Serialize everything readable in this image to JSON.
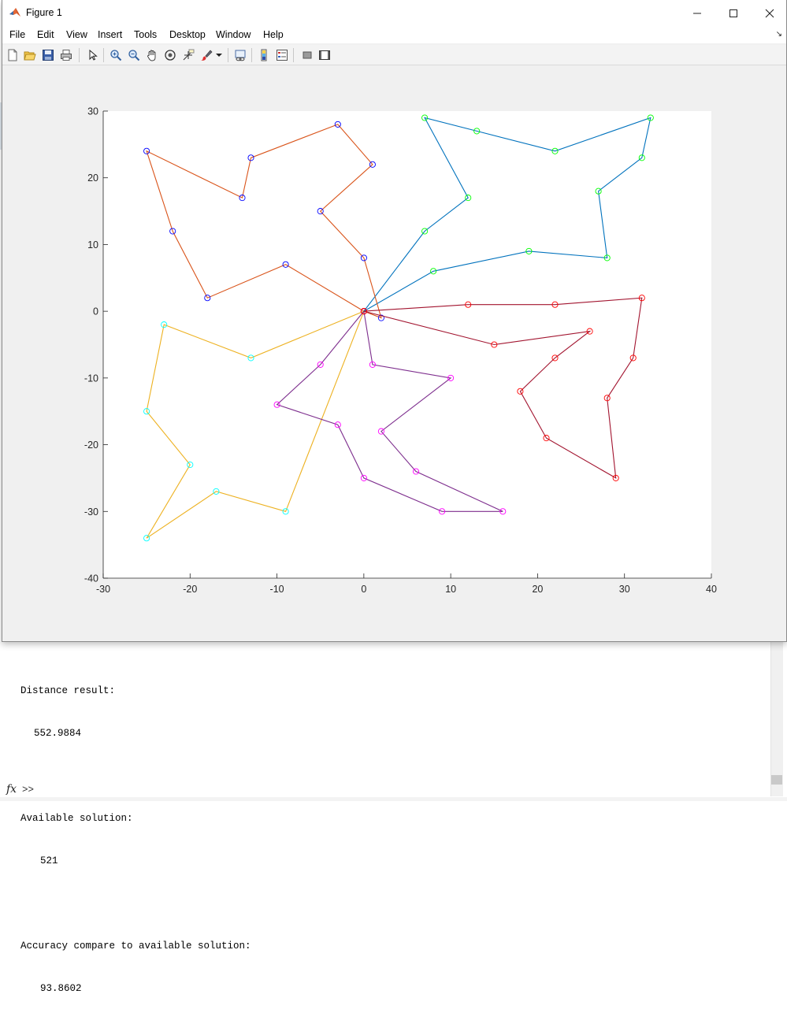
{
  "window": {
    "title": "Figure 1",
    "icon": "matlab-icon"
  },
  "menu": [
    "File",
    "Edit",
    "View",
    "Insert",
    "Tools",
    "Desktop",
    "Window",
    "Help"
  ],
  "toolbar": {
    "buttons": [
      "new-figure-icon",
      "open-file-icon",
      "save-icon",
      "print-icon",
      "edit-plot-arrow-icon",
      "zoom-in-icon",
      "zoom-out-icon",
      "pan-hand-icon",
      "rotate-3d-icon",
      "data-cursor-icon",
      "brush-icon",
      "brush-dropdown-icon",
      "link-plot-icon",
      "insert-colorbar-icon",
      "insert-legend-icon",
      "hide-plot-tools-icon",
      "show-plot-tools-icon"
    ]
  },
  "chart_data": {
    "type": "line",
    "title": "",
    "xlabel": "",
    "ylabel": "",
    "xlim": [
      -30,
      40
    ],
    "ylim": [
      -40,
      30
    ],
    "xticks": [
      -30,
      -20,
      -10,
      0,
      10,
      20,
      30,
      40
    ],
    "yticks": [
      -40,
      -30,
      -20,
      -10,
      0,
      10,
      20,
      30
    ],
    "grid": false,
    "series": [
      {
        "color": "#0072bd",
        "marker_color": "#00ff00",
        "points": [
          [
            0,
            0
          ],
          [
            8,
            6
          ],
          [
            19,
            9
          ],
          [
            28,
            8
          ],
          [
            27,
            18
          ],
          [
            32,
            23
          ],
          [
            33,
            29
          ],
          [
            22,
            24
          ],
          [
            13,
            27
          ],
          [
            7,
            29
          ],
          [
            12,
            17
          ],
          [
            7,
            12
          ],
          [
            0,
            0
          ]
        ]
      },
      {
        "color": "#d95319",
        "marker_color": "#0000ff",
        "points": [
          [
            0,
            0
          ],
          [
            2,
            -1
          ],
          [
            0,
            8
          ],
          [
            -5,
            15
          ],
          [
            1,
            22
          ],
          [
            -3,
            28
          ],
          [
            -13,
            23
          ],
          [
            -14,
            17
          ],
          [
            -25,
            24
          ],
          [
            -22,
            12
          ],
          [
            -18,
            2
          ],
          [
            -9,
            7
          ],
          [
            0,
            0
          ]
        ]
      },
      {
        "color": "#edb120",
        "marker_color": "#00ffff",
        "points": [
          [
            0,
            0
          ],
          [
            -13,
            -7
          ],
          [
            -23,
            -2
          ],
          [
            -25,
            -15
          ],
          [
            -20,
            -23
          ],
          [
            -25,
            -34
          ],
          [
            -17,
            -27
          ],
          [
            -9,
            -30
          ],
          [
            0,
            0
          ]
        ]
      },
      {
        "color": "#7e2f8e",
        "marker_color": "#ff00ff",
        "points": [
          [
            0,
            0
          ],
          [
            1,
            -8
          ],
          [
            10,
            -10
          ],
          [
            2,
            -18
          ],
          [
            6,
            -24
          ],
          [
            16,
            -30
          ],
          [
            9,
            -30
          ],
          [
            0,
            -25
          ],
          [
            -3,
            -17
          ],
          [
            -10,
            -14
          ],
          [
            -5,
            -8
          ],
          [
            0,
            0
          ]
        ]
      },
      {
        "color": "#a2142f",
        "marker_color": "#ff0000",
        "points": [
          [
            0,
            0
          ],
          [
            12,
            1
          ],
          [
            22,
            1
          ],
          [
            32,
            2
          ],
          [
            31,
            -7
          ],
          [
            28,
            -13
          ],
          [
            29,
            -25
          ],
          [
            21,
            -19
          ],
          [
            18,
            -12
          ],
          [
            22,
            -7
          ],
          [
            26,
            -3
          ],
          [
            15,
            -5
          ],
          [
            0,
            0
          ]
        ]
      }
    ]
  },
  "console": {
    "lines": [
      {
        "text": "Distance result:",
        "indent": 0
      },
      {
        "text": "552.9884",
        "indent": 1
      },
      {
        "text": "",
        "indent": 0
      },
      {
        "text": "Available solution:",
        "indent": 0
      },
      {
        "text": "521",
        "indent": 2
      },
      {
        "text": "",
        "indent": 0
      },
      {
        "text": "Accuracy compare to available solution:",
        "indent": 0
      },
      {
        "text": "93.8602",
        "indent": 2
      }
    ],
    "fx_label": "fx",
    "prompt": ">>"
  }
}
